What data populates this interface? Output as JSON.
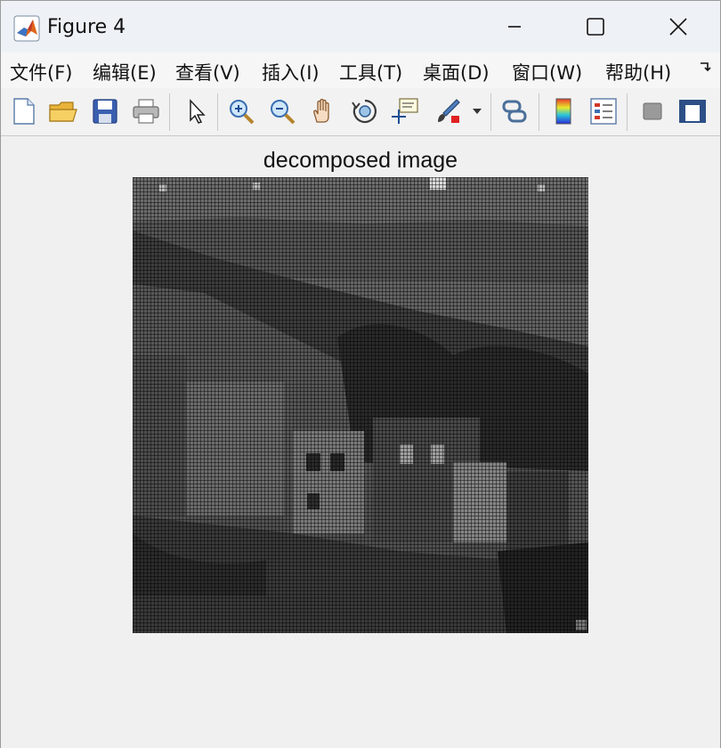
{
  "window": {
    "title": "Figure 4",
    "controls": [
      "minimize",
      "maximize",
      "close"
    ]
  },
  "menu": {
    "items": [
      {
        "label": "文件(F)",
        "name": "file"
      },
      {
        "label": "编辑(E)",
        "name": "edit"
      },
      {
        "label": "查看(V)",
        "name": "view"
      },
      {
        "label": "插入(I)",
        "name": "insert"
      },
      {
        "label": "工具(T)",
        "name": "tools"
      },
      {
        "label": "桌面(D)",
        "name": "desktop"
      },
      {
        "label": "窗口(W)",
        "name": "window"
      },
      {
        "label": "帮助(H)",
        "name": "help"
      }
    ],
    "overflow_icon": "overflow-arrow-icon"
  },
  "toolbar": {
    "buttons": [
      "new-figure-icon",
      "open-file-icon",
      "save-icon",
      "print-icon",
      "select-arrow-icon",
      "zoom-in-icon",
      "zoom-out-icon",
      "pan-hand-icon",
      "rotate-3d-icon",
      "data-cursor-icon",
      "brush-icon",
      "link-plot-icon",
      "colorbar-icon",
      "legend-icon",
      "hide-plot-tools-icon",
      "show-plot-tools-icon"
    ]
  },
  "figure": {
    "axes_title": "decomposed image"
  }
}
